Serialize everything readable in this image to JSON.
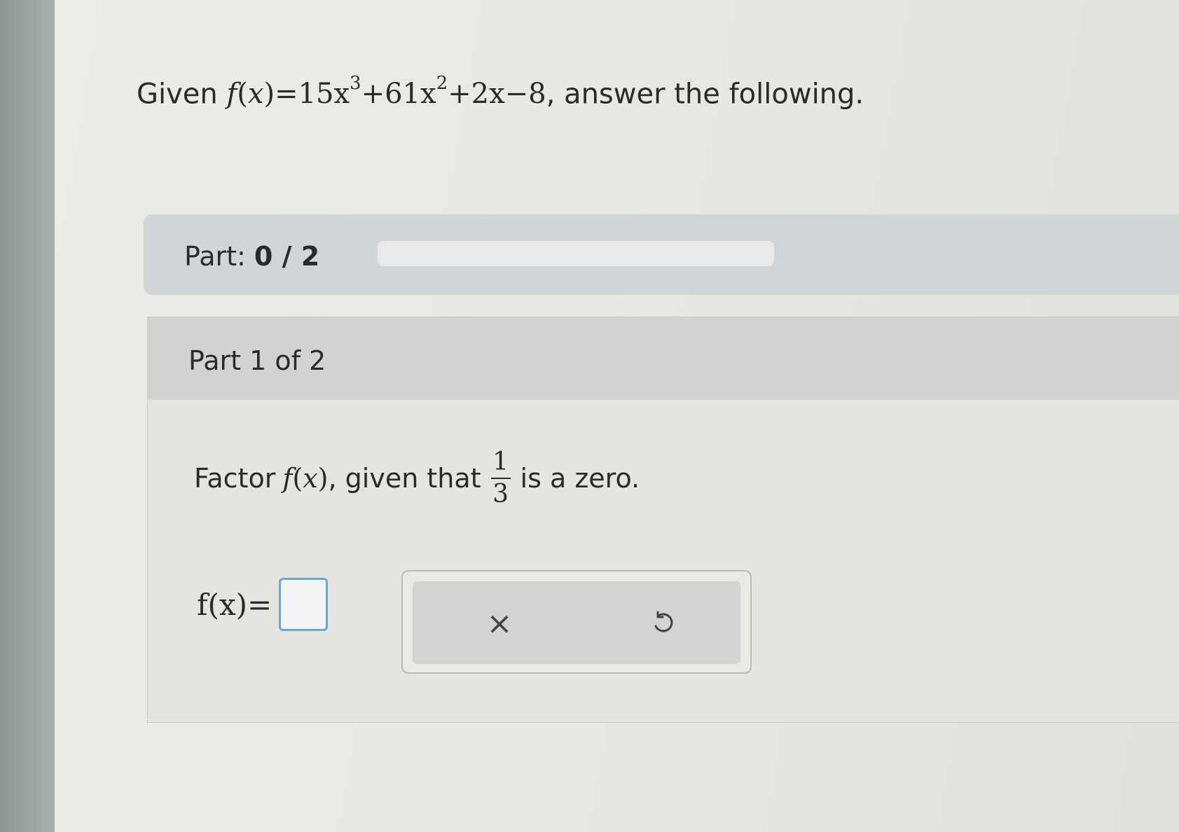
{
  "question": {
    "given": "Given",
    "func": "f",
    "var": "x",
    "eq": "=15x",
    "exp3": "3",
    "term2": "+61x",
    "exp2": "2",
    "tail": "+2x−8",
    "rest": ", answer the following."
  },
  "part_bar": {
    "label": "Part:",
    "progress_text": "0 / 2",
    "progress_fraction": 0
  },
  "section": {
    "title": "Part 1 of 2",
    "instruction_pre": "Factor",
    "instruction_mid": ", given that",
    "zero_num": "1",
    "zero_den": "3",
    "instruction_post": "is a zero.",
    "answer_lhs": "f(x)=",
    "answer_value": ""
  },
  "tools": {
    "clear_icon": "close-icon",
    "clear_glyph": "×",
    "undo_icon": "undo-icon"
  },
  "colors": {
    "accent": "#6aa6cf",
    "part_bar_bg": "#d0d5d7",
    "section_header_bg": "#d2d3d1"
  }
}
